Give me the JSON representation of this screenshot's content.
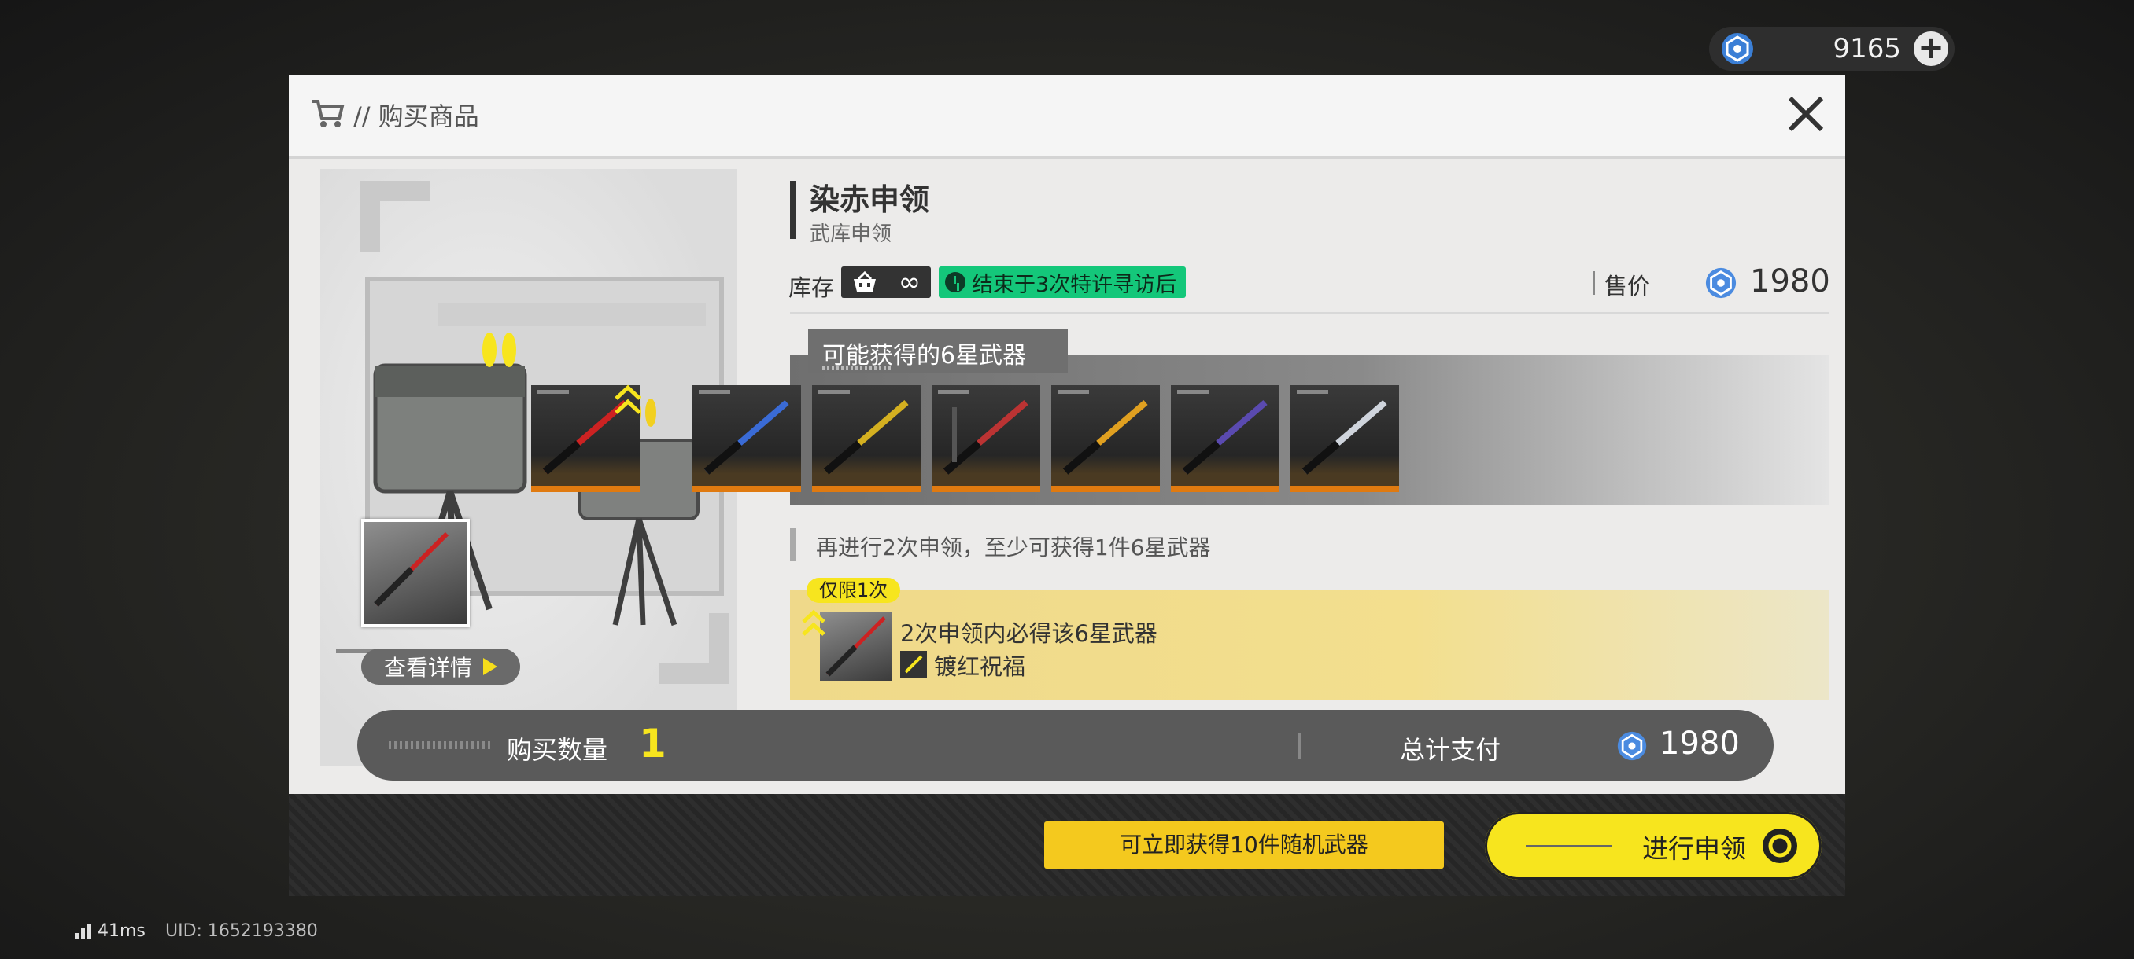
{
  "currency": {
    "amount": "9165",
    "plus_label": "+"
  },
  "modal": {
    "title": "// 购买商品",
    "item": {
      "name": "染赤申领",
      "subname": "武库申领"
    },
    "stock": {
      "label": "库存",
      "value": "∞",
      "time_badge": "结束于3次特许寻访后"
    },
    "price": {
      "label": "售价",
      "value": "1980"
    },
    "weapons": {
      "tab": "可能获得的6星武器",
      "count": 7
    },
    "note": "再进行2次申领，至少可获得1件6星武器",
    "guarantee": {
      "tag": "仅限1次",
      "line1": "2次申领内必得该6星武器",
      "line2": "镀红祝福"
    },
    "detail_button": "查看详情",
    "quantity": {
      "label": "购买数量",
      "value": "1"
    },
    "total": {
      "label": "总计支付",
      "value": "1980"
    },
    "hint_button": "可立即获得10件随机武器",
    "go_button": "进行申领"
  },
  "footer": {
    "ping": "41ms",
    "uid": "UID: 1652193380"
  },
  "colors": {
    "accent_yellow": "#f7e51e",
    "badge_green": "#14c77a",
    "rarity_orange": "#e07a10"
  },
  "icons": [
    "cart-icon",
    "close-icon",
    "gem-icon",
    "plus-icon",
    "clock-icon",
    "infinity-icon",
    "play-triangle-icon",
    "chevron-up-icon",
    "refresh-icon",
    "signal-icon"
  ]
}
